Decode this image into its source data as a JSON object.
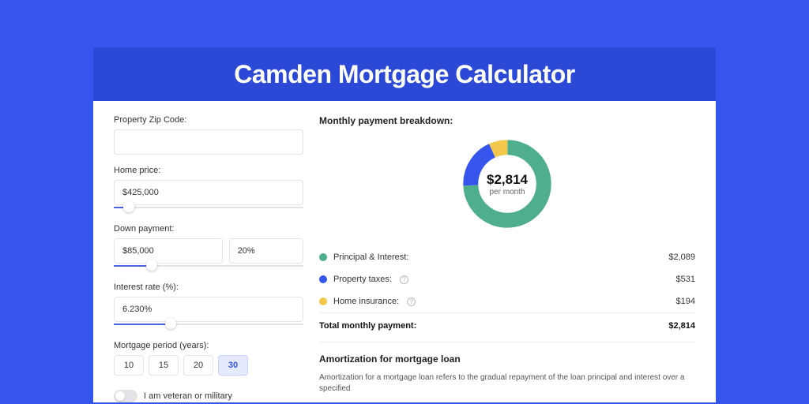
{
  "page_title": "Camden Mortgage Calculator",
  "form": {
    "zip_label": "Property Zip Code:",
    "zip_value": "",
    "price_label": "Home price:",
    "price_value": "$425,000",
    "price_slider_pct": 8,
    "down_label": "Down payment:",
    "down_value": "$85,000",
    "down_pct_value": "20%",
    "down_slider_pct": 20,
    "rate_label": "Interest rate (%):",
    "rate_value": "6.230%",
    "rate_slider_pct": 30,
    "period_label": "Mortgage period (years):",
    "periods": [
      "10",
      "15",
      "20",
      "30"
    ],
    "period_active": "30",
    "veteran_label": "I am veteran or military"
  },
  "breakdown": {
    "title": "Monthly payment breakdown:",
    "center_amount": "$2,814",
    "center_sub": "per month",
    "items": [
      {
        "label": "Principal & Interest:",
        "value": "$2,089",
        "color": "#4fae8b",
        "help": false
      },
      {
        "label": "Property taxes:",
        "value": "$531",
        "color": "#3655ec",
        "help": true
      },
      {
        "label": "Home insurance:",
        "value": "$194",
        "color": "#f1c84b",
        "help": true
      }
    ],
    "total_label": "Total monthly payment:",
    "total_value": "$2,814"
  },
  "amort": {
    "title": "Amortization for mortgage loan",
    "text": "Amortization for a mortgage loan refers to the gradual repayment of the loan principal and interest over a specified"
  },
  "chart_data": {
    "type": "pie",
    "title": "Monthly payment breakdown",
    "series": [
      {
        "name": "Principal & Interest",
        "value": 2089,
        "color": "#4fae8b"
      },
      {
        "name": "Property taxes",
        "value": 531,
        "color": "#3655ec"
      },
      {
        "name": "Home insurance",
        "value": 194,
        "color": "#f1c84b"
      }
    ],
    "total": 2814,
    "center_label": "$2,814 per month"
  }
}
